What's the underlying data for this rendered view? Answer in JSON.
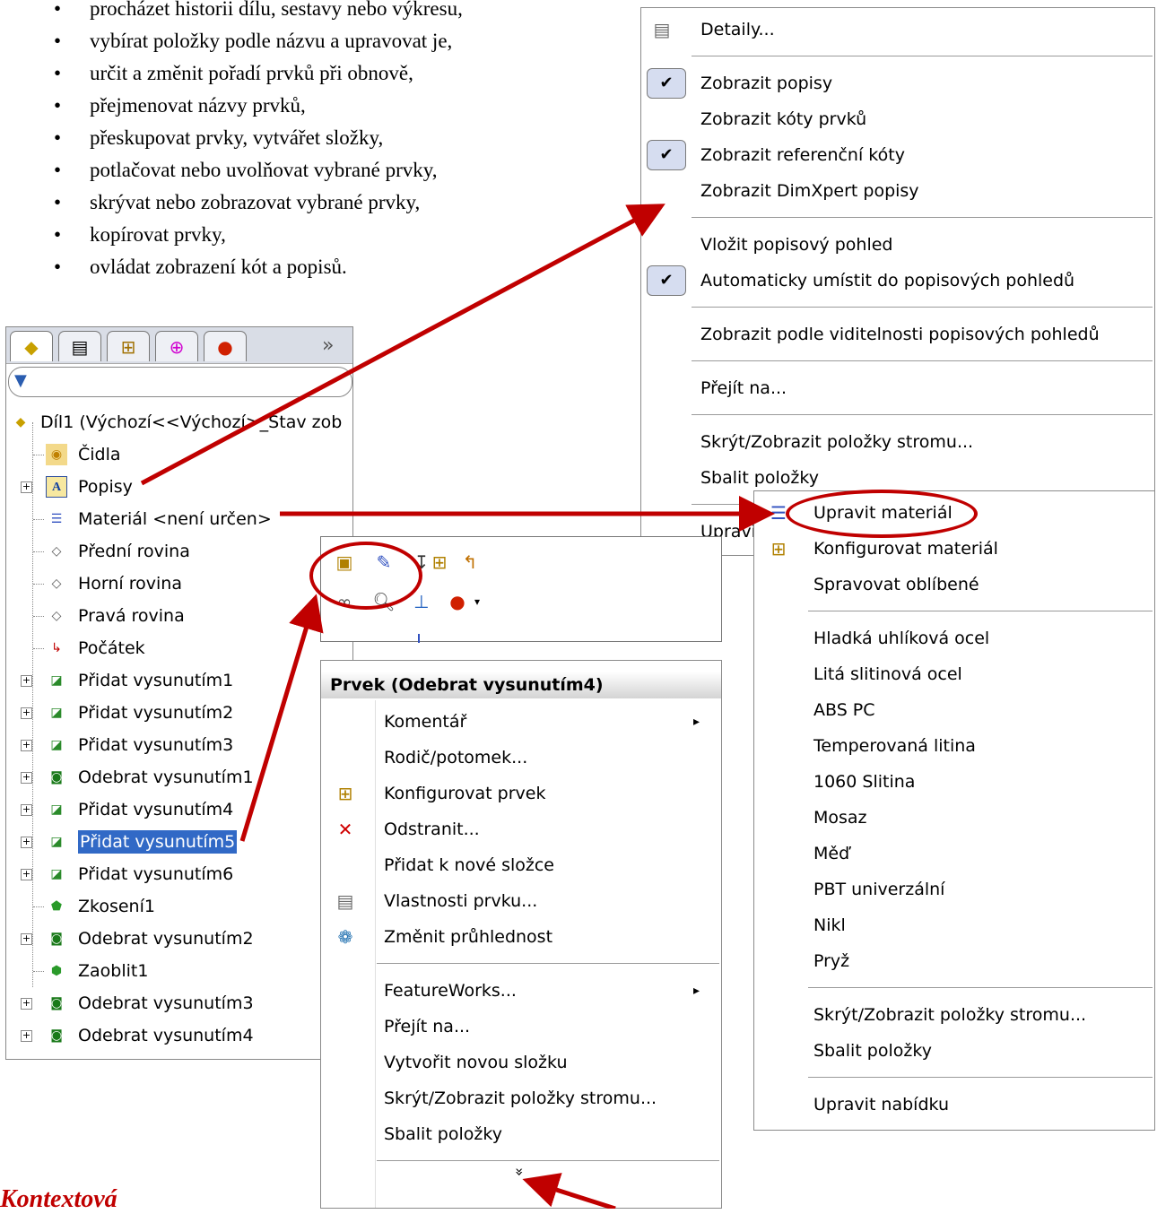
{
  "bullets": [
    "procházet historii dílu, sestavy nebo výkresu,",
    "vybírat položky podle názvu a upravovat je,",
    "určit a změnit pořadí prvků při obnově,",
    "přejmenovat názvy prvků,",
    "přeskupovat prvky, vytvářet složky,",
    "potlačovat nebo uvolňovat vybrané prvky,",
    "skrývat nebo zobrazovat vybrané prvky,",
    "kopírovat prvky,",
    "ovládat zobrazení kót a popisů."
  ],
  "bottom_heading": "Kontextová",
  "annotations_menu": {
    "items": [
      {
        "label": "Detaily...",
        "icon": "properties-icon"
      },
      {
        "sep": true
      },
      {
        "label": "Zobrazit popisy",
        "checked": true
      },
      {
        "label": "Zobrazit kóty prvků"
      },
      {
        "label": "Zobrazit referenční kóty",
        "checked": true
      },
      {
        "label": "Zobrazit DimXpert popisy"
      },
      {
        "sep": true
      },
      {
        "label": "Vložit popisový pohled"
      },
      {
        "label": "Automaticky umístit do popisových pohledů",
        "checked": true
      },
      {
        "sep": true
      },
      {
        "label": "Zobrazit podle viditelnosti popisových pohledů"
      },
      {
        "sep": true
      },
      {
        "label": "Přejít na..."
      },
      {
        "sep": true
      },
      {
        "label": "Skrýt/Zobrazit položky stromu..."
      },
      {
        "label": "Sbalit položky"
      },
      {
        "sep": true
      },
      {
        "label": "Upravit nabídku"
      }
    ]
  },
  "material_menu": {
    "items": [
      {
        "label": "Upravit materiál",
        "icon": "material-icon"
      },
      {
        "label": "Konfigurovat materiál",
        "icon": "configure-icon"
      },
      {
        "label": "Spravovat oblíbené"
      },
      {
        "sep": true
      },
      {
        "label": "Hladká uhlíková ocel"
      },
      {
        "label": "Litá slitinová ocel"
      },
      {
        "label": "ABS PC"
      },
      {
        "label": "Temperovaná litina"
      },
      {
        "label": "1060 Slitina"
      },
      {
        "label": "Mosaz"
      },
      {
        "label": "Měď"
      },
      {
        "label": "PBT univerzální"
      },
      {
        "label": "Nikl"
      },
      {
        "label": "Pryž"
      },
      {
        "sep": true
      },
      {
        "label": "Skrýt/Zobrazit položky stromu..."
      },
      {
        "label": "Sbalit položky"
      },
      {
        "sep": true
      },
      {
        "label": "Upravit nabídku"
      }
    ]
  },
  "feature_menu": {
    "header": "Prvek (Odebrat vysunutím4)",
    "items": [
      {
        "label": "Komentář",
        "submenu": true
      },
      {
        "label": "Rodič/potomek..."
      },
      {
        "label": "Konfigurovat prvek",
        "icon": "configure-icon"
      },
      {
        "label": "Odstranit...",
        "icon": "delete-icon"
      },
      {
        "label": "Přidat k nové složce"
      },
      {
        "label": "Vlastnosti prvku...",
        "icon": "properties-icon"
      },
      {
        "label": "Změnit průhlednost",
        "icon": "transparency-icon"
      },
      {
        "sep": true
      },
      {
        "label": "FeatureWorks...",
        "submenu": true
      },
      {
        "label": "Přejít na..."
      },
      {
        "label": "Vytvořit novou složku"
      },
      {
        "label": "Skrýt/Zobrazit položky stromu..."
      },
      {
        "label": "Sbalit položky"
      },
      {
        "sep": true
      }
    ],
    "more": "»"
  },
  "tree": {
    "tabs_more": "»",
    "root": "Díl1  (Výchozí<<Výchozí>_Stav zob",
    "items": [
      {
        "label": "Čidla",
        "icon": "sensors-icon",
        "exp": false
      },
      {
        "label": "Popisy",
        "icon": "annotations-icon",
        "exp": true
      },
      {
        "label": "Materiál <není určen>",
        "icon": "material-icon",
        "exp": false
      },
      {
        "label": "Přední rovina",
        "icon": "plane-icon",
        "exp": false
      },
      {
        "label": "Horní rovina",
        "icon": "plane-icon",
        "exp": false
      },
      {
        "label": "Pravá rovina",
        "icon": "plane-icon",
        "exp": false
      },
      {
        "label": "Počátek",
        "icon": "origin-icon",
        "exp": false
      },
      {
        "label": "Přidat vysunutím1",
        "icon": "boss-extrude-icon",
        "exp": true
      },
      {
        "label": "Přidat vysunutím2",
        "icon": "boss-extrude-icon",
        "exp": true
      },
      {
        "label": "Přidat vysunutím3",
        "icon": "boss-extrude-icon",
        "exp": true
      },
      {
        "label": "Odebrat vysunutím1",
        "icon": "cut-extrude-icon",
        "exp": true
      },
      {
        "label": "Přidat vysunutím4",
        "icon": "boss-extrude-icon",
        "exp": true
      },
      {
        "label": "Přidat vysunutím5",
        "icon": "boss-extrude-icon",
        "exp": true,
        "selected": true
      },
      {
        "label": "Přidat vysunutím6",
        "icon": "boss-extrude-icon",
        "exp": true
      },
      {
        "label": "Zkosení1",
        "icon": "chamfer-icon",
        "exp": false
      },
      {
        "label": "Odebrat vysunutím2",
        "icon": "cut-extrude-icon",
        "exp": true
      },
      {
        "label": "Zaoblit1",
        "icon": "fillet-icon",
        "exp": false
      },
      {
        "label": "Odebrat vysunutím3",
        "icon": "cut-extrude-icon",
        "exp": true
      },
      {
        "label": "Odebrat vysunutím4",
        "icon": "cut-extrude-icon",
        "exp": true
      }
    ]
  }
}
